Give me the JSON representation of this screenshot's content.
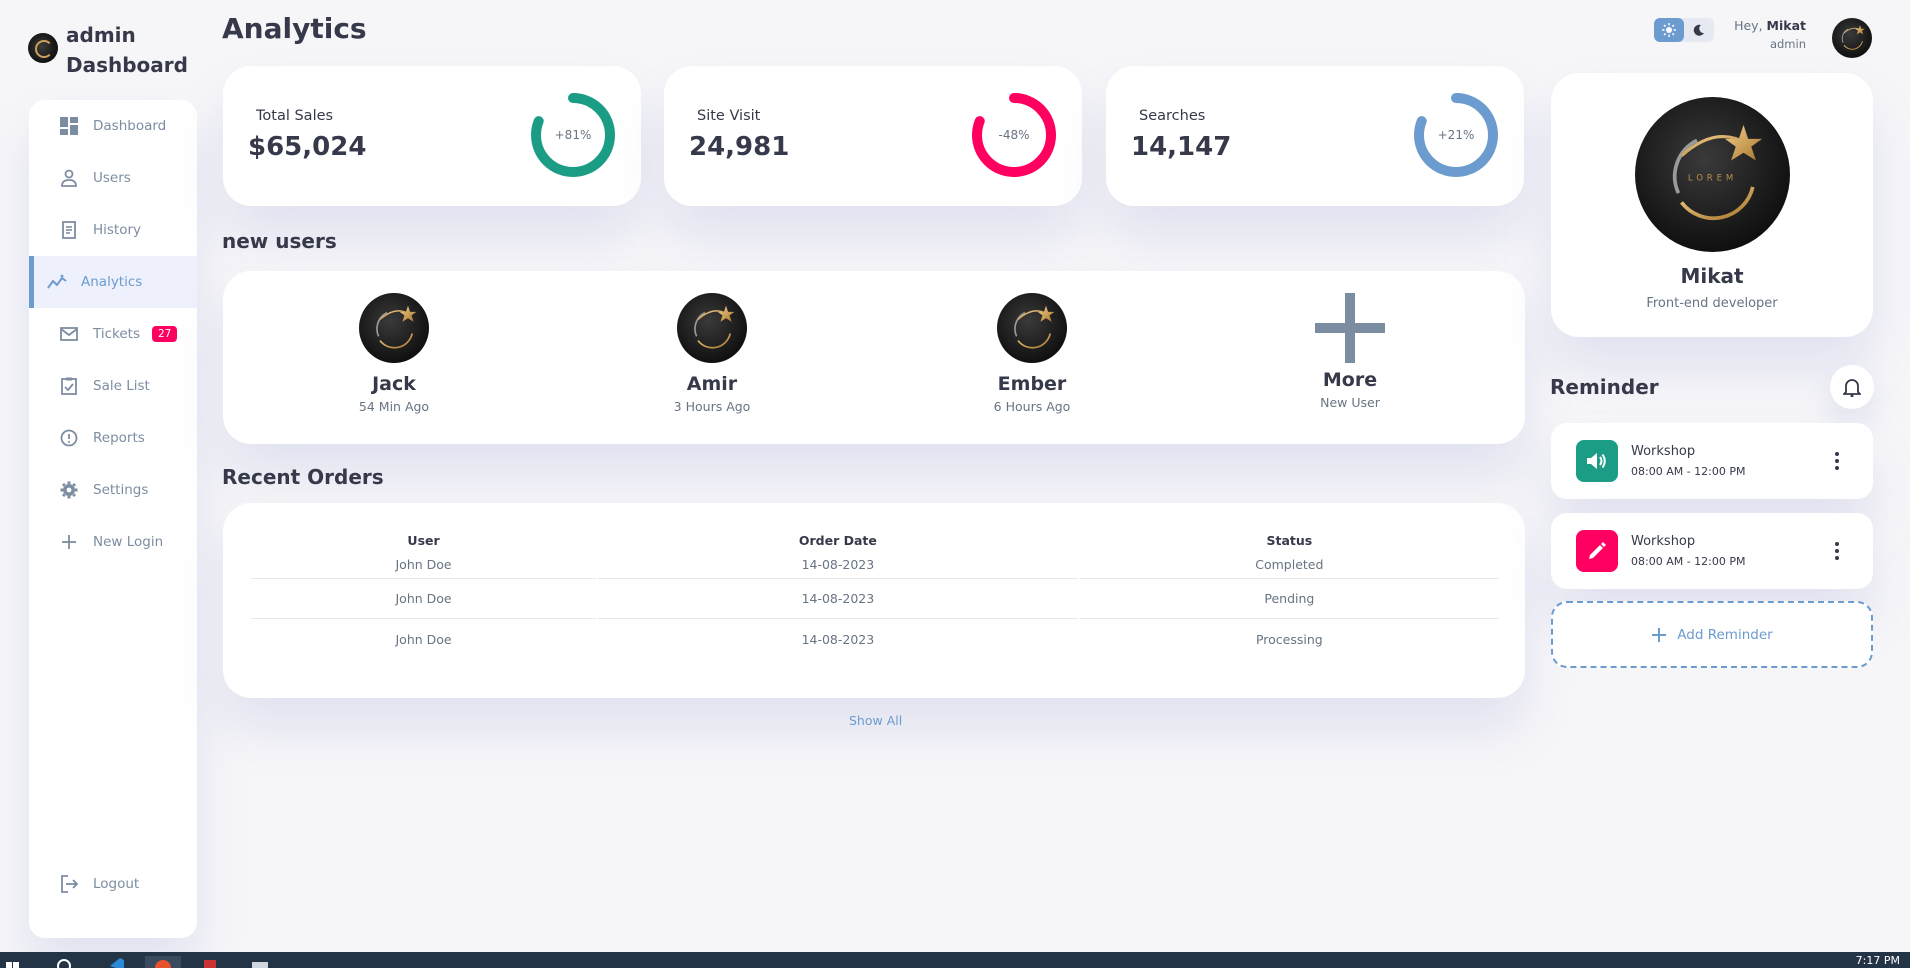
{
  "brand": {
    "line1": "admin",
    "line2": "Dashboard"
  },
  "sidebar": {
    "items": [
      {
        "label": "Dashboard",
        "icon": "grid-icon"
      },
      {
        "label": "Users",
        "icon": "person-icon"
      },
      {
        "label": "History",
        "icon": "receipt-icon"
      },
      {
        "label": "Analytics",
        "icon": "insights-icon",
        "active": true
      },
      {
        "label": "Tickets",
        "icon": "mail-icon",
        "badge": "27"
      },
      {
        "label": "Sale List",
        "icon": "clipboard-check-icon"
      },
      {
        "label": "Reports",
        "icon": "alert-circle-icon"
      },
      {
        "label": "Settings",
        "icon": "gear-icon"
      },
      {
        "label": "New Login",
        "icon": "plus-icon"
      }
    ],
    "logout": "Logout"
  },
  "header": {
    "title": "Analytics",
    "greeting": "Hey,",
    "user_name": "Mikat",
    "user_role": "admin"
  },
  "stats": [
    {
      "label": "Total Sales",
      "value": "$65,024",
      "percent": "+81%",
      "ring_fraction": 0.81,
      "color": "#1b9c85"
    },
    {
      "label": "Site Visit",
      "value": "24,981",
      "percent": "-48%",
      "ring_fraction": 0.81,
      "color": "#ff0060"
    },
    {
      "label": "Searches",
      "value": "14,147",
      "percent": "+21%",
      "ring_fraction": 0.81,
      "color": "#6c9bcf"
    }
  ],
  "new_users": {
    "title": "new users",
    "users": [
      {
        "name": "Jack",
        "time": "54 Min Ago"
      },
      {
        "name": "Amir",
        "time": "3 Hours Ago"
      },
      {
        "name": "Ember",
        "time": "6 Hours Ago"
      },
      {
        "name": "More",
        "time": "New User"
      }
    ]
  },
  "orders": {
    "title": "Recent Orders",
    "columns": [
      "User",
      "Order Date",
      "Status"
    ],
    "rows": [
      [
        "John Doe",
        "14-08-2023",
        "Completed"
      ],
      [
        "John Doe",
        "14-08-2023",
        "Pending"
      ],
      [
        "John Doe",
        "14-08-2023",
        "Processing"
      ]
    ],
    "show_all": "Show All"
  },
  "profile": {
    "name": "Mikat",
    "role": "Front-end developer",
    "logo_text": "LOREM"
  },
  "reminders": {
    "title": "Reminder",
    "items": [
      {
        "title": "Workshop",
        "time": "08:00 AM - 12:00 PM",
        "icon": "volume-icon",
        "color": "#1b9c85"
      },
      {
        "title": "Workshop",
        "time": "08:00 AM - 12:00 PM",
        "icon": "pencil-icon",
        "color": "#ff0060"
      }
    ],
    "add_label": "Add Reminder"
  },
  "taskbar": {
    "clock": "7:17 PM"
  },
  "colors": {
    "primary": "#6c9bcf",
    "danger": "#ff0060",
    "success": "#1b9c85",
    "dark": "#363949",
    "info": "#7d8da1",
    "background": "#f6f6f9"
  }
}
